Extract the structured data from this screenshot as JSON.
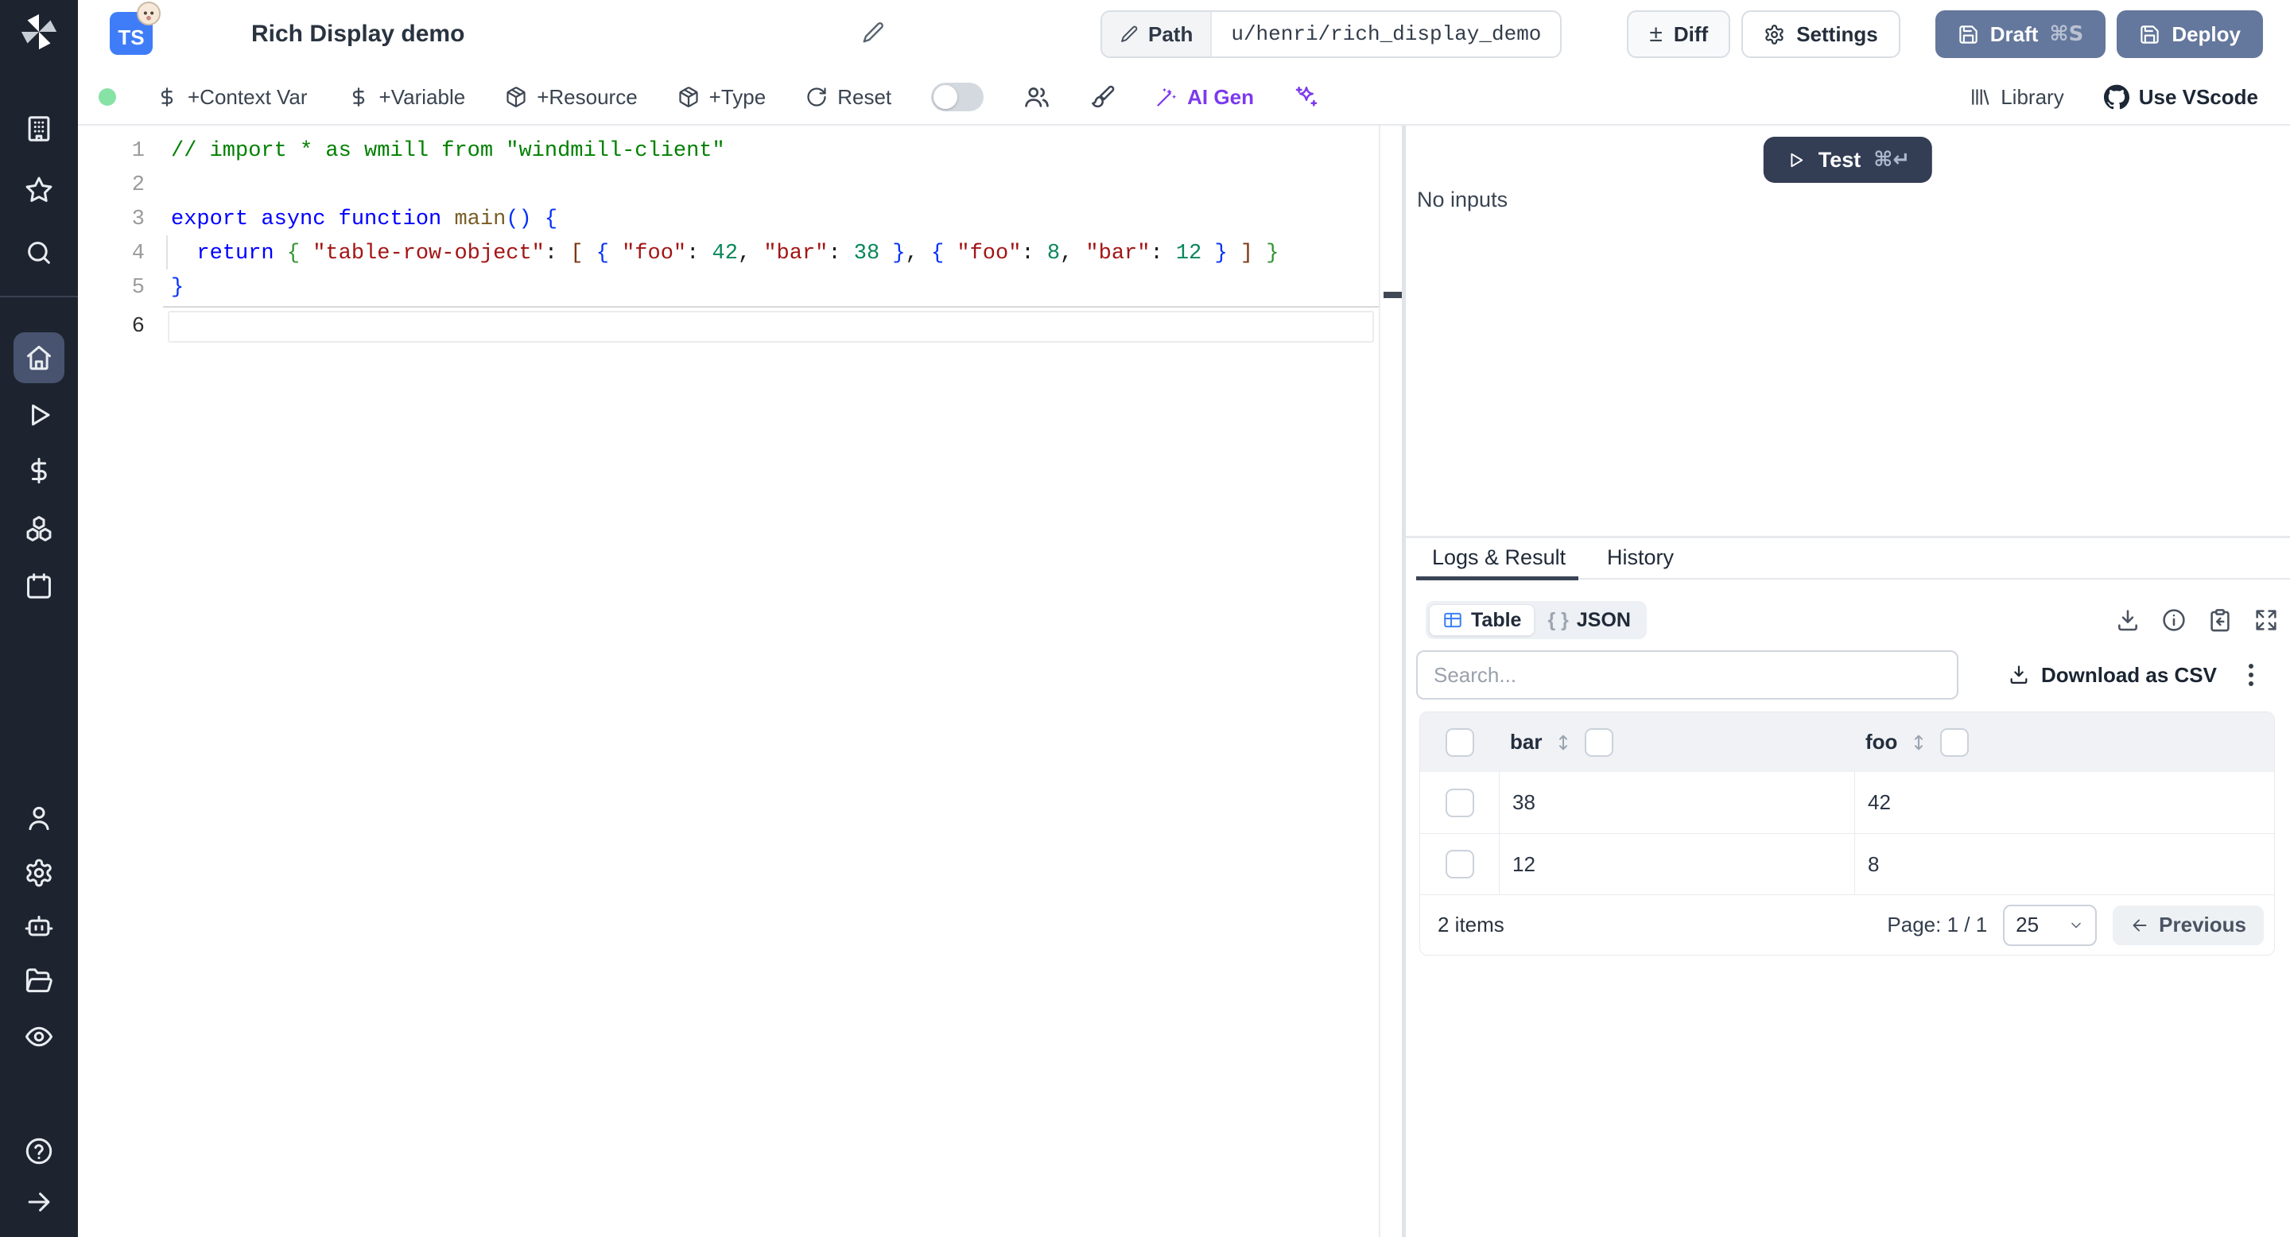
{
  "sidebar": {
    "logo": "windmill-logo",
    "top_items": [
      {
        "icon": "building",
        "label": "workspace"
      },
      {
        "icon": "star",
        "label": "favorites"
      },
      {
        "icon": "search",
        "label": "search"
      }
    ],
    "main_items": [
      {
        "icon": "home",
        "label": "home",
        "active": true
      },
      {
        "icon": "play",
        "label": "runs"
      },
      {
        "icon": "dollar",
        "label": "variables"
      },
      {
        "icon": "boxes",
        "label": "resources"
      },
      {
        "icon": "calendar",
        "label": "schedules"
      }
    ],
    "bottom_items": [
      {
        "icon": "user",
        "label": "account"
      },
      {
        "icon": "gear",
        "label": "settings"
      },
      {
        "icon": "bot",
        "label": "workers"
      },
      {
        "icon": "folder-open",
        "label": "folders"
      },
      {
        "icon": "eye",
        "label": "audit-logs"
      }
    ],
    "footer_items": [
      {
        "icon": "help",
        "label": "help"
      },
      {
        "icon": "arrow-right",
        "label": "expand-sidebar"
      }
    ]
  },
  "header": {
    "language_badge": "TS",
    "title": "Rich Display demo",
    "path_label": "Path",
    "path_value": "u/henri/rich_display_demo",
    "diff_label": "Diff",
    "settings_label": "Settings",
    "draft_label": "Draft",
    "draft_shortcut": "⌘S",
    "deploy_label": "Deploy"
  },
  "toolbar": {
    "status_color": "#87E2A6",
    "add_context_var": "+Context Var",
    "add_variable": "+Variable",
    "add_resource": "+Resource",
    "add_type": "+Type",
    "reset": "Reset",
    "ai_gen": "AI Gen",
    "ai_accent": "#7C3AED",
    "library": "Library",
    "use_vscode": "Use VScode"
  },
  "editor": {
    "lines": [
      {
        "n": "1",
        "tokens": [
          {
            "c": "comment",
            "t": "// import * as wmill from \"windmill-client\""
          }
        ]
      },
      {
        "n": "2",
        "tokens": []
      },
      {
        "n": "3",
        "tokens": [
          {
            "c": "kw",
            "t": "export"
          },
          {
            "c": "pl",
            "t": " "
          },
          {
            "c": "kw",
            "t": "async"
          },
          {
            "c": "pl",
            "t": " "
          },
          {
            "c": "kw",
            "t": "function"
          },
          {
            "c": "pl",
            "t": " "
          },
          {
            "c": "fn",
            "t": "main"
          },
          {
            "c": "b1",
            "t": "()"
          },
          {
            "c": "pl",
            "t": " "
          },
          {
            "c": "b1",
            "t": "{"
          }
        ]
      },
      {
        "n": "4",
        "guide": true,
        "tokens": [
          {
            "c": "pl",
            "t": "  "
          },
          {
            "c": "kw",
            "t": "return"
          },
          {
            "c": "pl",
            "t": " "
          },
          {
            "c": "b2",
            "t": "{"
          },
          {
            "c": "pl",
            "t": " "
          },
          {
            "c": "str",
            "t": "\"table-row-object\""
          },
          {
            "c": "pl",
            "t": ": "
          },
          {
            "c": "b3",
            "t": "["
          },
          {
            "c": "pl",
            "t": " "
          },
          {
            "c": "b1",
            "t": "{"
          },
          {
            "c": "pl",
            "t": " "
          },
          {
            "c": "str",
            "t": "\"foo\""
          },
          {
            "c": "pl",
            "t": ": "
          },
          {
            "c": "num",
            "t": "42"
          },
          {
            "c": "pl",
            "t": ", "
          },
          {
            "c": "str",
            "t": "\"bar\""
          },
          {
            "c": "pl",
            "t": ": "
          },
          {
            "c": "num",
            "t": "38"
          },
          {
            "c": "pl",
            "t": " "
          },
          {
            "c": "b1",
            "t": "}"
          },
          {
            "c": "pl",
            "t": ", "
          },
          {
            "c": "b1",
            "t": "{"
          },
          {
            "c": "pl",
            "t": " "
          },
          {
            "c": "str",
            "t": "\"foo\""
          },
          {
            "c": "pl",
            "t": ": "
          },
          {
            "c": "num",
            "t": "8"
          },
          {
            "c": "pl",
            "t": ", "
          },
          {
            "c": "str",
            "t": "\"bar\""
          },
          {
            "c": "pl",
            "t": ": "
          },
          {
            "c": "num",
            "t": "12"
          },
          {
            "c": "pl",
            "t": " "
          },
          {
            "c": "b1",
            "t": "}"
          },
          {
            "c": "pl",
            "t": " "
          },
          {
            "c": "b3",
            "t": "]"
          },
          {
            "c": "pl",
            "t": " "
          },
          {
            "c": "b2",
            "t": "}"
          }
        ]
      },
      {
        "n": "5",
        "tokens": [
          {
            "c": "b1",
            "t": "}"
          }
        ]
      },
      {
        "n": "6",
        "tokens": [],
        "active": true
      }
    ]
  },
  "run_panel": {
    "test_label": "Test",
    "test_shortcut": "⌘↵",
    "no_inputs": "No inputs"
  },
  "result_panel": {
    "tabs": [
      {
        "label": "Logs & Result",
        "active": true
      },
      {
        "label": "History",
        "active": false
      }
    ],
    "view_switch": {
      "table_label": "Table",
      "json_braces": "{ }",
      "json_label": "JSON"
    },
    "search_placeholder": "Search...",
    "download_csv_label": "Download as CSV",
    "table": {
      "columns": [
        "bar",
        "foo"
      ],
      "rows": [
        [
          "38",
          "42"
        ],
        [
          "12",
          "8"
        ]
      ],
      "items_count": "2 items",
      "page_label": "Page: 1 / 1",
      "page_size": "25",
      "previous_label": "Previous"
    }
  }
}
